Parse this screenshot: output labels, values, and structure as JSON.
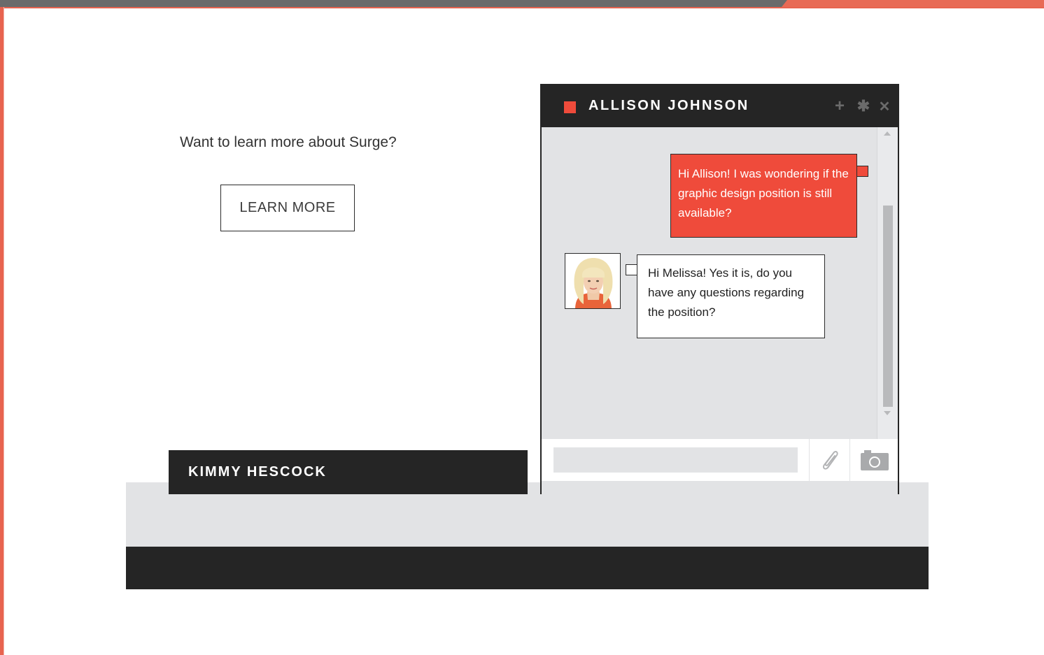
{
  "promo": {
    "question": "Want to learn more about Surge?",
    "button_label": "LEARN MORE"
  },
  "contact_bar": {
    "name": "KIMMY HESCOCK"
  },
  "chat": {
    "title": "ALLISON JOHNSON",
    "status_color": "#ef4b3b",
    "header_icons": [
      "plus-icon",
      "gear-icon",
      "close-icon"
    ],
    "header_glyphs": {
      "plus": "+",
      "gear": "✱",
      "close": "✕"
    },
    "messages": [
      {
        "direction": "outgoing",
        "text": "Hi Allison! I was wondering if the graphic design position is still available?"
      },
      {
        "direction": "incoming",
        "text": "Hi Melissa! Yes it is, do you have any questions regarding the position?"
      }
    ],
    "input": {
      "value": "",
      "placeholder": ""
    },
    "footer_icons": [
      "paperclip-icon",
      "camera-icon"
    ]
  },
  "colors": {
    "accent": "#ef4b3b",
    "dark": "#252525",
    "light_gray": "#e2e3e5",
    "frame_top": "#6b6b6b"
  }
}
